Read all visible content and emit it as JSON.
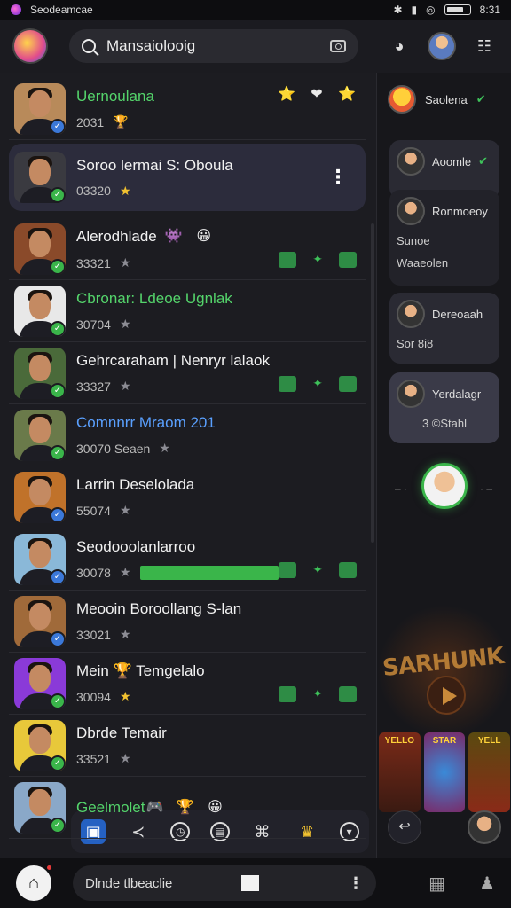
{
  "status_bar": {
    "app_name": "Seodeamcae",
    "time": "8:31",
    "icons": [
      "bluetooth-icon",
      "nfc-icon",
      "wifi-icon",
      "battery-icon"
    ]
  },
  "top_bar": {
    "search_query": "Mansaiolooig"
  },
  "chats": [
    {
      "name": "Uernoulana",
      "name_color": "green",
      "sub": "2031",
      "sub_icon": "🏆",
      "verify": "blue",
      "badges": [
        "⭐",
        "❤",
        "⭐"
      ]
    },
    {
      "name": "Soroo lermai S: Oboula",
      "sub": "03320",
      "selected": true,
      "verify": "green"
    },
    {
      "name": "Alerodhlade",
      "sub": "33321",
      "verify": "green",
      "badges": [
        "👾",
        "😀"
      ]
    },
    {
      "name": "Cbronar: Ldeoe Ugnlak",
      "name_color": "green",
      "sub": "30704",
      "verify": "green"
    },
    {
      "name": "Gehrcaraham | Nenryr lalaok",
      "sub": "33327",
      "verify": "green"
    },
    {
      "name": "Comnnrr Mraom 201",
      "name_color": "blue",
      "sub": "30070 Seaen",
      "verify": "green"
    },
    {
      "name": "Larrin Deselolada",
      "sub": "55074",
      "verify": "blue"
    },
    {
      "name": "Seodooolanlarroo",
      "sub": "30078",
      "verify": "blue"
    },
    {
      "name": "Meooin Boroollang S-lan",
      "sub": "33021",
      "verify": "blue"
    },
    {
      "name": "Mein 🏆 Temgelalo",
      "sub": "30094",
      "verify": "green"
    },
    {
      "name": "Dbrde Temair",
      "sub": "33521",
      "verify": "green"
    },
    {
      "name": "Geelmolet",
      "name_color": "green",
      "sub": "",
      "verify": "green",
      "badges": [
        "🎮",
        "🏆",
        "😀"
      ]
    }
  ],
  "side_panel": {
    "top_label": "Saolena",
    "cards": [
      {
        "label": "Aoomle"
      },
      {
        "label": "Ronmoeoy",
        "sub1": "Sunoe",
        "sub2": "Waaeolen"
      },
      {
        "label": "Dereoaah",
        "sub1": "Sor 8i8"
      },
      {
        "label": "Yerdalagr",
        "sub1": "3 ©Stahl"
      }
    ],
    "banner_text": "SARHUNK",
    "tiles": [
      "YELLO",
      "STAR",
      "YELL"
    ]
  },
  "bottom_nav": {
    "search_text": "Dlnde tlbeaclie"
  },
  "colors": {
    "accent_green": "#3ab54a",
    "accent_blue": "#3b78d8",
    "panel_bg": "#1c1c21"
  }
}
